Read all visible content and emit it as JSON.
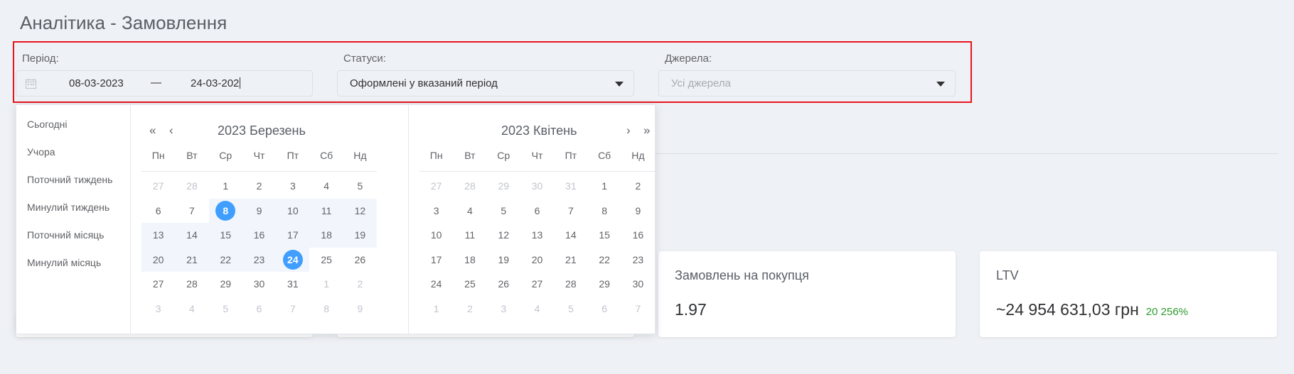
{
  "page": {
    "title": "Аналітика - Замовлення"
  },
  "filters": {
    "period_label": "Період:",
    "date_start": "08-03-2023",
    "date_separator": "—",
    "date_end": "24-03-202",
    "status_label": "Статуси:",
    "status_value": "Оформлені у вказаний період",
    "source_label": "Джерела:",
    "source_placeholder": "Усі джерела"
  },
  "shortcuts": [
    "Сьогодні",
    "Учора",
    "Поточний тиждень",
    "Минулий тиждень",
    "Поточний місяць",
    "Минулий місяць"
  ],
  "weekdays": [
    "Пн",
    "Вт",
    "Ср",
    "Чт",
    "Пт",
    "Сб",
    "Нд"
  ],
  "left_month": {
    "title": "2023 Березень",
    "weeks": [
      [
        "27",
        "28",
        "1",
        "2",
        "3",
        "4",
        "5"
      ],
      [
        "6",
        "7",
        "8",
        "9",
        "10",
        "11",
        "12"
      ],
      [
        "13",
        "14",
        "15",
        "16",
        "17",
        "18",
        "19"
      ],
      [
        "20",
        "21",
        "22",
        "23",
        "24",
        "25",
        "26"
      ],
      [
        "27",
        "28",
        "29",
        "30",
        "31",
        "1",
        "2"
      ],
      [
        "3",
        "4",
        "5",
        "6",
        "7",
        "8",
        "9"
      ]
    ],
    "range_start": "8",
    "range_end": "24"
  },
  "right_month": {
    "title": "2023 Квітень",
    "weeks": [
      [
        "27",
        "28",
        "29",
        "30",
        "31",
        "1",
        "2"
      ],
      [
        "3",
        "4",
        "5",
        "6",
        "7",
        "8",
        "9"
      ],
      [
        "10",
        "11",
        "12",
        "13",
        "14",
        "15",
        "16"
      ],
      [
        "17",
        "18",
        "19",
        "20",
        "21",
        "22",
        "23"
      ],
      [
        "24",
        "25",
        "26",
        "27",
        "28",
        "29",
        "30"
      ],
      [
        "1",
        "2",
        "3",
        "4",
        "5",
        "6",
        "7"
      ]
    ]
  },
  "cards": {
    "orders_per_buyer": {
      "title": "Замовлень на покупця",
      "value": "1.97"
    },
    "ltv": {
      "title": "LTV",
      "value": "~24 954 631,03 грн",
      "delta": "20 256%"
    }
  },
  "colors": {
    "accent": "#409eff",
    "highlight_border": "#e8161c",
    "positive": "#2e9b2e"
  }
}
